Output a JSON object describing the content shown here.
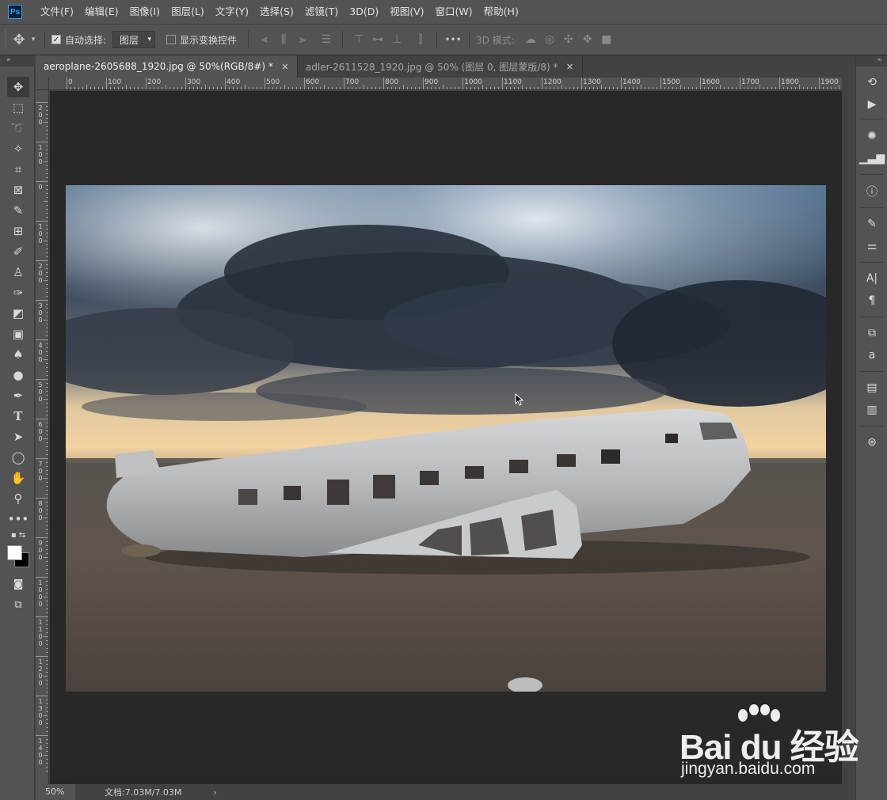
{
  "app": {
    "logo_text": "Ps"
  },
  "menu": [
    "文件(F)",
    "编辑(E)",
    "图像(I)",
    "图层(L)",
    "文字(Y)",
    "选择(S)",
    "滤镜(T)",
    "3D(D)",
    "视图(V)",
    "窗口(W)",
    "帮助(H)"
  ],
  "options": {
    "auto_select_label": "自动选择:",
    "auto_select_value": "图层",
    "show_transform_label": "显示变换控件",
    "mode_3d_label": "3D 模式:",
    "more_label": "•••"
  },
  "tabs": [
    {
      "label": "aeroplane-2605688_1920.jpg @ 50%(RGB/8#) *",
      "close": "×"
    },
    {
      "label": "adler-2611528_1920.jpg @ 50% (图层 0, 图层蒙版/8) *",
      "close": "×"
    }
  ],
  "ruler_top": [
    "0",
    "100",
    "200",
    "300",
    "400",
    "500",
    "600",
    "700",
    "800",
    "900",
    "1000",
    "1100",
    "1200",
    "1300",
    "1400",
    "1500",
    "1600",
    "1700",
    "1800",
    "1900"
  ],
  "ruler_left": [
    "2\n0\n0",
    "1\n0\n0",
    "0",
    "1\n0\n0",
    "2\n0\n0",
    "3\n0\n0",
    "4\n0\n0",
    "5\n0\n0",
    "6\n0\n0",
    "7\n0\n0",
    "8\n0\n0",
    "9\n0\n0",
    "1\n0\n0\n0",
    "1\n1\n0\n0",
    "1\n2\n0\n0",
    "1\n3\n0\n0",
    "1\n4\n0\n0"
  ],
  "status": {
    "zoom": "50%",
    "doc_info": "文档:7.03M/7.03M",
    "arrow": "›"
  },
  "watermark": {
    "main": "Bai du 经验",
    "sub": "jingyan.baidu.com"
  },
  "panel_collapse": "»",
  "dock_collapse": "«",
  "colors": {
    "menu_bg": "#535353",
    "canvas_bg": "#282828",
    "accent": "#31a8ff"
  }
}
